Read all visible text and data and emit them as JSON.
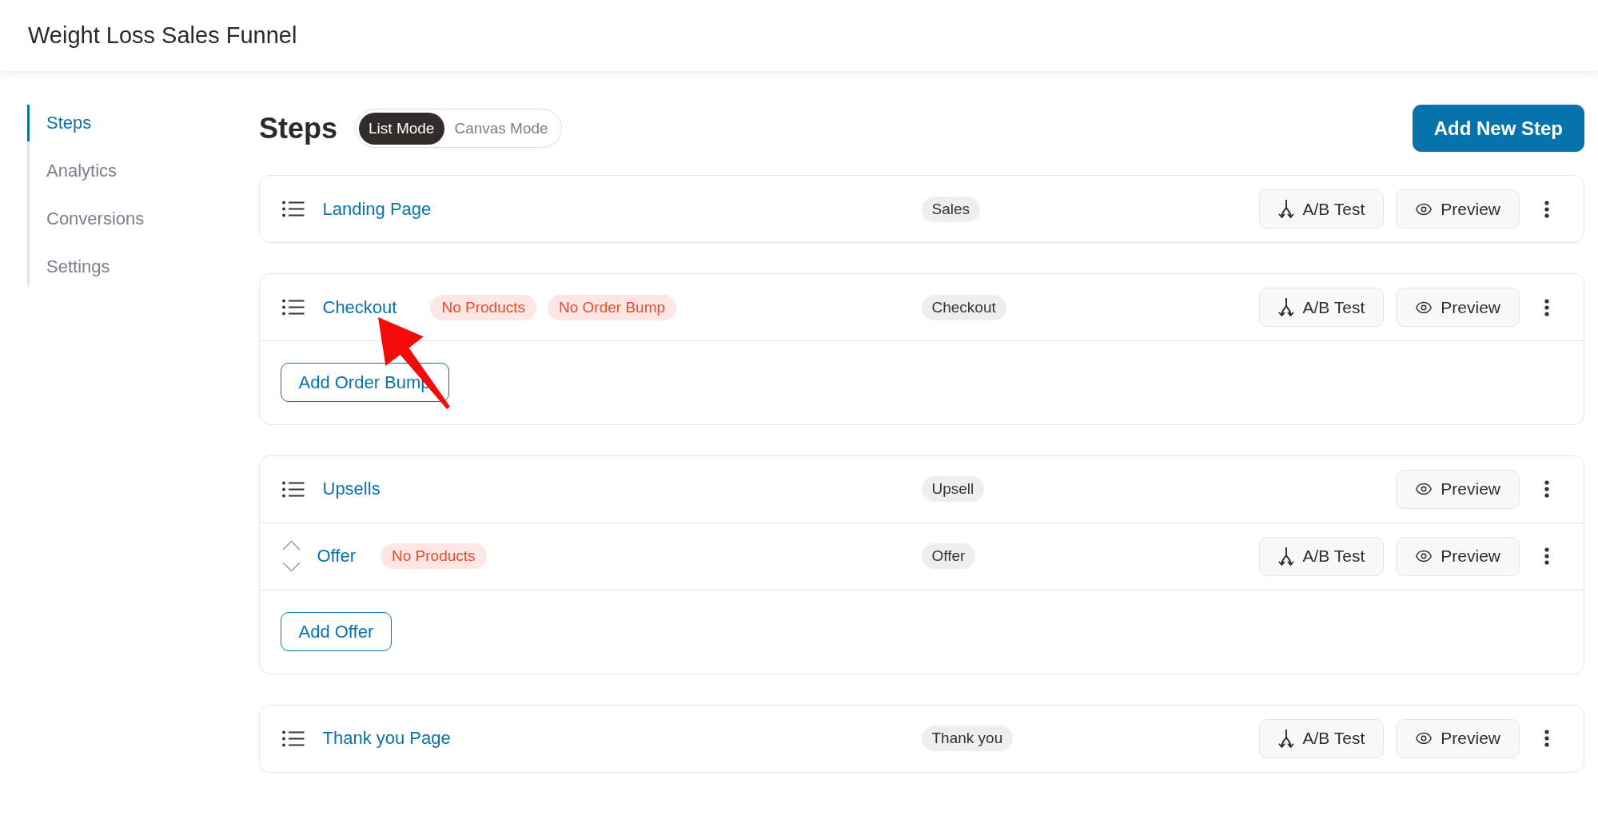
{
  "header": {
    "title": "Weight Loss Sales Funnel"
  },
  "sidebar": {
    "items": [
      {
        "label": "Steps",
        "selected": true
      },
      {
        "label": "Analytics",
        "selected": false
      },
      {
        "label": "Conversions",
        "selected": false
      },
      {
        "label": "Settings",
        "selected": false
      }
    ]
  },
  "main": {
    "title": "Steps",
    "view_modes": [
      {
        "label": "List Mode",
        "selected": true
      },
      {
        "label": "Canvas Mode",
        "selected": false
      }
    ],
    "add_button": "Add New Step"
  },
  "steps": [
    {
      "rows": [
        {
          "kind": "step",
          "title": "Landing Page",
          "type": "Sales",
          "ab_test": "A/B Test",
          "preview": "Preview"
        }
      ]
    },
    {
      "rows": [
        {
          "kind": "step",
          "title": "Checkout",
          "badges": [
            "No Products",
            "No Order Bump"
          ],
          "type": "Checkout",
          "ab_test": "A/B Test",
          "preview": "Preview"
        }
      ],
      "footer_button": "Add Order Bump"
    },
    {
      "rows": [
        {
          "kind": "step",
          "title": "Upsells",
          "type": "Upsell",
          "preview": "Preview"
        },
        {
          "kind": "offer",
          "title": "Offer",
          "badges": [
            "No Products"
          ],
          "type": "Offer",
          "ab_test": "A/B Test",
          "preview": "Preview"
        }
      ],
      "footer_button": "Add Offer"
    },
    {
      "rows": [
        {
          "kind": "step",
          "title": "Thank you Page",
          "type": "Thank you",
          "ab_test": "A/B Test",
          "preview": "Preview"
        }
      ]
    }
  ]
}
